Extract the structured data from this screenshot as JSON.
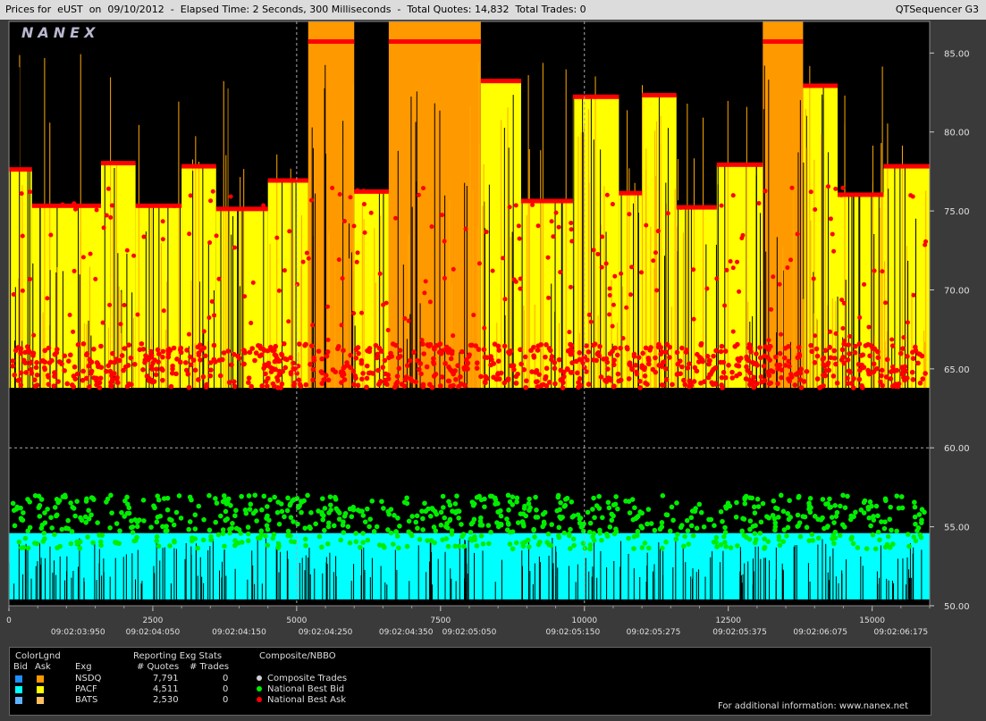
{
  "header": {
    "title": "Prices for  eUST  on  09/10/2012  -  Elapsed Time: 2 Seconds, 300 Milliseconds  -  Total Quotes: 14,832  Total Trades: 0",
    "app_name": "QTSequencer G3"
  },
  "brand": "NANEX",
  "chart_data": {
    "type": "scatter",
    "y_ticks": [
      "85.00",
      "80.00",
      "75.00",
      "70.00",
      "65.00",
      "60.00",
      "55.00",
      "50.00"
    ],
    "ylim": [
      50,
      87
    ],
    "x_ticks": [
      "0",
      "2500",
      "5000",
      "7500",
      "10000",
      "12500",
      "15000"
    ],
    "xlim": [
      0,
      16000
    ],
    "time_labels": [
      "09:02:03:950",
      "09:02:04:050",
      "09:02:04:150",
      "09:02:04:250",
      "09:02:04:350",
      "09:02:05:050",
      "09:02:05:150",
      "09:02:05:275",
      "09:02:05:375",
      "09:02:06:075",
      "09:02:06:175"
    ],
    "time_label_x": [
      1200,
      2500,
      4000,
      5500,
      6900,
      8000,
      9800,
      11200,
      12700,
      14100,
      15500
    ],
    "grid": "dashed at 5000 and 10000 / 60.00",
    "ask_steps": [
      {
        "x0": 0,
        "x1": 400,
        "y": 77.6
      },
      {
        "x0": 400,
        "x1": 1600,
        "y": 75.3
      },
      {
        "x0": 1600,
        "x1": 2200,
        "y": 78.0
      },
      {
        "x0": 2200,
        "x1": 3000,
        "y": 75.3
      },
      {
        "x0": 3000,
        "x1": 3600,
        "y": 77.8
      },
      {
        "x0": 3600,
        "x1": 4500,
        "y": 75.1
      },
      {
        "x0": 4500,
        "x1": 5200,
        "y": 76.9
      },
      {
        "x0": 5200,
        "x1": 6000,
        "y": 85.7
      },
      {
        "x0": 6000,
        "x1": 6600,
        "y": 76.2
      },
      {
        "x0": 6600,
        "x1": 8200,
        "y": 85.7
      },
      {
        "x0": 8200,
        "x1": 8900,
        "y": 83.2
      },
      {
        "x0": 8900,
        "x1": 9800,
        "y": 75.6
      },
      {
        "x0": 9800,
        "x1": 10600,
        "y": 82.2
      },
      {
        "x0": 10600,
        "x1": 11000,
        "y": 76.1
      },
      {
        "x0": 11000,
        "x1": 11600,
        "y": 82.3
      },
      {
        "x0": 11600,
        "x1": 12300,
        "y": 75.2
      },
      {
        "x0": 12300,
        "x1": 13100,
        "y": 77.9
      },
      {
        "x0": 13100,
        "x1": 13800,
        "y": 85.7
      },
      {
        "x0": 13800,
        "x1": 14400,
        "y": 82.9
      },
      {
        "x0": 14400,
        "x1": 15200,
        "y": 76.0
      },
      {
        "x0": 15200,
        "x1": 16000,
        "y": 77.8
      }
    ],
    "series": [
      {
        "name": "National Best Bid",
        "color": "#00ee00",
        "band": [
          53.6,
          57.0
        ]
      },
      {
        "name": "National Best Ask",
        "color": "#ff0000",
        "band": [
          63.8,
          66.6
        ]
      }
    ]
  },
  "legend": {
    "color_legend_label": "ColorLgnd",
    "bid_label": "Bid",
    "ask_label": "Ask",
    "exch_label": "Exg",
    "stats_label": "Reporting Exg Stats",
    "quotes_label": "# Quotes",
    "trades_label": "# Trades",
    "composite_label": "Composite/NBBO",
    "rows": [
      {
        "exchange": "NSDQ",
        "quotes": "7,791",
        "trades": "0",
        "bid_color": "#1e90ff",
        "ask_color": "#ff9900"
      },
      {
        "exchange": "PACF",
        "quotes": "4,511",
        "trades": "0",
        "bid_color": "#00ffff",
        "ask_color": "#ffff00"
      },
      {
        "exchange": "BATS",
        "quotes": "2,530",
        "trades": "0",
        "bid_color": "#5fb4ff",
        "ask_color": "#ffc060"
      }
    ],
    "composite": [
      {
        "label": "Composite Trades",
        "color": "#d0d0d0"
      },
      {
        "label": "National Best Bid",
        "color": "#00ee00"
      },
      {
        "label": "National Best Ask",
        "color": "#ff0000"
      }
    ],
    "info": "For additional information: www.nanex.net"
  }
}
